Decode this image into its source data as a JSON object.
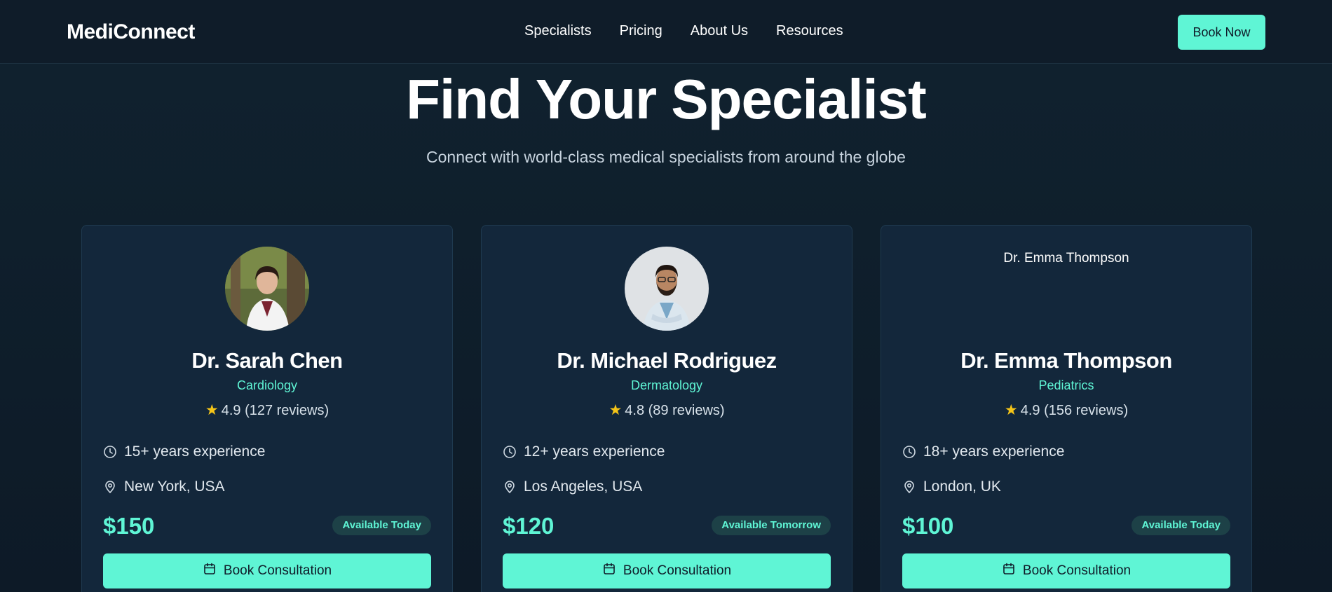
{
  "brand": {
    "logo": "MediConnect"
  },
  "nav": {
    "links": [
      "Specialists",
      "Pricing",
      "About Us",
      "Resources"
    ],
    "cta": "Book Now"
  },
  "hero": {
    "title": "Find Your Specialist",
    "subtitle": "Connect with world-class medical specialists from around the globe"
  },
  "colors": {
    "accent": "#5ff5d5",
    "background": "#0f1d2a",
    "card": "#13273b",
    "star": "#f5c518"
  },
  "doctors": [
    {
      "name": "Dr. Sarah Chen",
      "specialty": "Cardiology",
      "rating": "4.9 (127 reviews)",
      "experience": "15+ years experience",
      "location": "New York, USA",
      "price": "$150",
      "availability": "Available Today",
      "button": "Book Consultation"
    },
    {
      "name": "Dr. Michael Rodriguez",
      "specialty": "Dermatology",
      "rating": "4.8 (89 reviews)",
      "experience": "12+ years experience",
      "location": "Los Angeles, USA",
      "price": "$120",
      "availability": "Available Tomorrow",
      "button": "Book Consultation"
    },
    {
      "name": "Dr. Emma Thompson",
      "specialty": "Pediatrics",
      "rating": "4.9 (156 reviews)",
      "experience": "18+ years experience",
      "location": "London, UK",
      "price": "$100",
      "availability": "Available Today",
      "button": "Book Consultation",
      "image_alt": "Dr. Emma Thompson"
    }
  ],
  "icons": {
    "rating": "star-icon",
    "experience": "clock-icon",
    "location": "map-pin-icon",
    "book": "calendar-icon"
  }
}
